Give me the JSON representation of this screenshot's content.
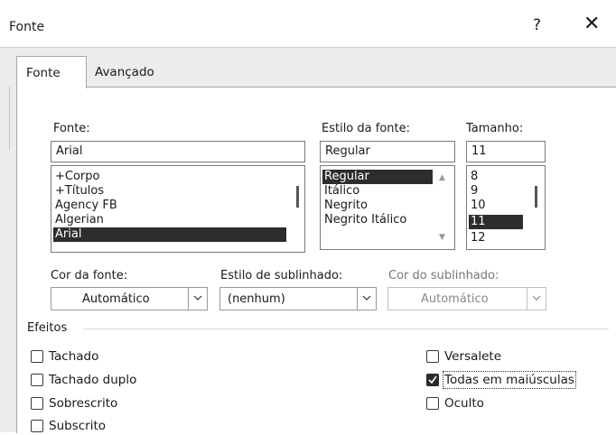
{
  "dialog": {
    "title": "Fonte",
    "help_label": "?",
    "close_label": "✕"
  },
  "tabs": [
    {
      "label": "Fonte"
    },
    {
      "label": "Avançado"
    }
  ],
  "font": {
    "label": "Fonte:",
    "value": "Arial",
    "items": [
      "+Corpo",
      "+Títulos",
      "Agency FB",
      "Algerian",
      "Arial"
    ],
    "selected": "Arial"
  },
  "style": {
    "label": "Estilo da fonte:",
    "value": "Regular",
    "items": [
      "Regular",
      "Itálico",
      "Negrito",
      "Negrito Itálico"
    ],
    "selected": "Regular"
  },
  "size": {
    "label": "Tamanho:",
    "value": "11",
    "items": [
      "8",
      "9",
      "10",
      "11",
      "12"
    ],
    "selected": "11"
  },
  "font_color": {
    "label": "Cor da fonte:",
    "value": "Automático"
  },
  "underline_style": {
    "label": "Estilo de sublinhado:",
    "value": "(nenhum)"
  },
  "underline_color": {
    "label": "Cor do sublinhado:",
    "value": "Automático",
    "enabled": false
  },
  "effects": {
    "label": "Efeitos",
    "left": [
      {
        "label": "Tachado",
        "checked": false
      },
      {
        "label": "Tachado duplo",
        "checked": false
      },
      {
        "label": "Sobrescrito",
        "checked": false
      },
      {
        "label": "Subscrito",
        "checked": false
      }
    ],
    "right": [
      {
        "label": "Versalete",
        "checked": false
      },
      {
        "label": "Todas em maiúsculas",
        "checked": true
      },
      {
        "label": "Oculto",
        "checked": false
      }
    ]
  }
}
